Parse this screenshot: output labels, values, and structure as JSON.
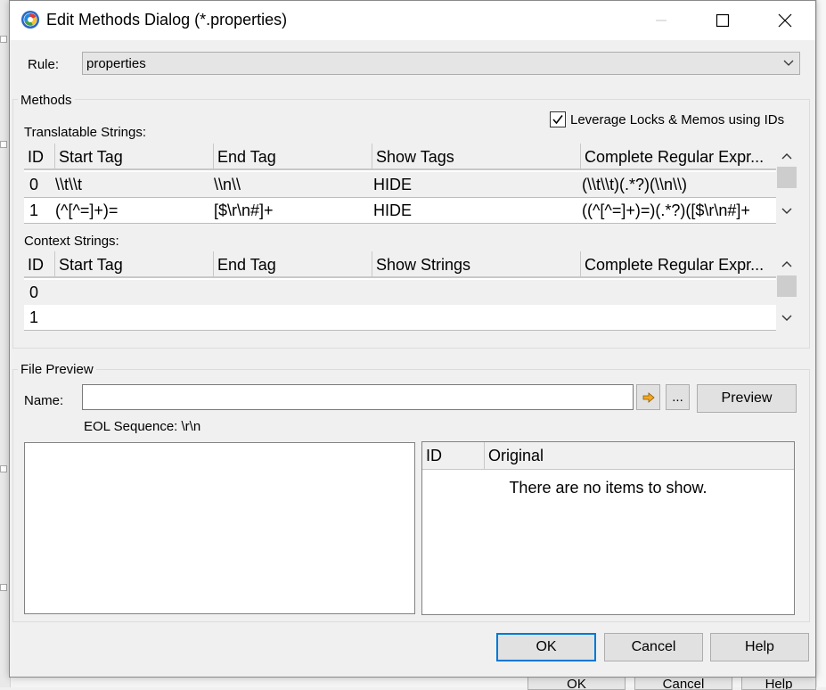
{
  "window": {
    "title": "Edit Methods Dialog (*.properties)",
    "minimize_icon": "minimize-icon",
    "maximize_icon": "maximize-icon",
    "close_icon": "close-icon"
  },
  "rule": {
    "label": "Rule:",
    "value": "properties"
  },
  "methods": {
    "group_title": "Methods",
    "leverage_label": "Leverage Locks & Memos using IDs",
    "leverage_checked": true,
    "translatable": {
      "label": "Translatable Strings:",
      "columns": [
        "ID",
        "Start Tag",
        "End Tag",
        "Show Tags",
        "Complete Regular Expr..."
      ],
      "rows": [
        [
          "0",
          "\\\\t\\\\t",
          "\\\\n\\\\",
          "HIDE",
          "(\\\\t\\\\t)(.*?)(\\\\n\\\\)"
        ],
        [
          "1",
          "(^[^=]+)=",
          "[$\\r\\n#]+",
          "HIDE",
          "((^[^=]+)=)(.*?)([$\\r\\n#]+"
        ]
      ]
    },
    "context": {
      "label": "Context Strings:",
      "columns": [
        "ID",
        "Start Tag",
        "End Tag",
        "Show Strings",
        "Complete Regular Expr..."
      ],
      "rows": [
        [
          "0",
          "",
          "",
          "",
          ""
        ],
        [
          "1",
          "",
          "",
          "",
          ""
        ]
      ]
    }
  },
  "file_preview": {
    "group_title": "File Preview",
    "name_label": "Name:",
    "name_value": "",
    "browse_label": "...",
    "preview_button": "Preview",
    "eol_text": "EOL Sequence: \\r\\n",
    "list_columns": [
      "ID",
      "Original"
    ],
    "empty_message": "There are no items to show."
  },
  "buttons": {
    "ok": "OK",
    "cancel": "Cancel",
    "help": "Help"
  },
  "background": {
    "ok": "OK",
    "cancel": "Cancel",
    "help": "Help"
  },
  "colors": {
    "dialog_bg": "#f0f0f0",
    "accent": "#0078d7",
    "button_bg": "#e1e1e1"
  }
}
